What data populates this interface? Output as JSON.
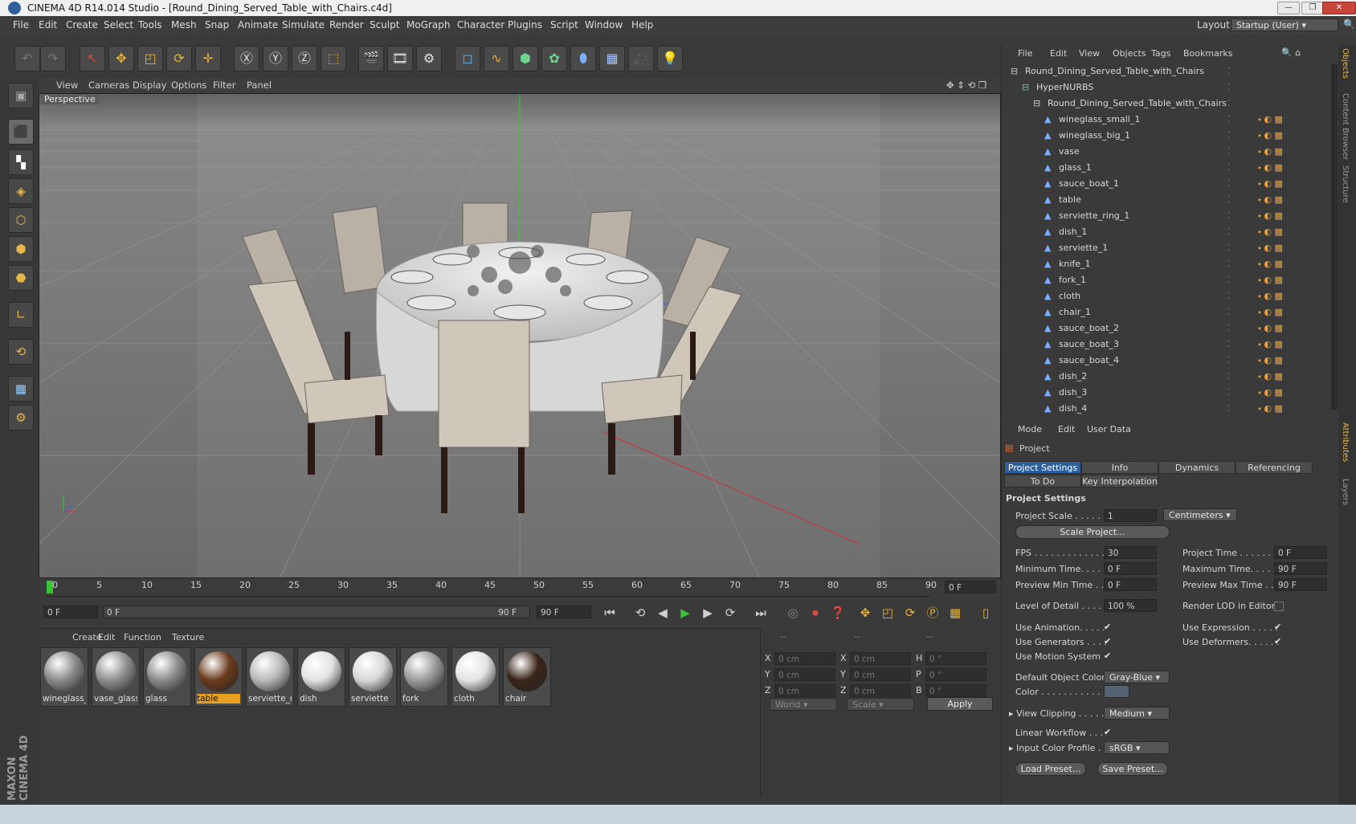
{
  "window": {
    "title": "CINEMA 4D R14.014 Studio - [Round_Dining_Served_Table_with_Chairs.c4d]"
  },
  "menubar": {
    "items": [
      "File",
      "Edit",
      "Create",
      "Select",
      "Tools",
      "Mesh",
      "Snap",
      "Animate",
      "Simulate",
      "Render",
      "Sculpt",
      "MoGraph",
      "Character",
      "Plugins",
      "Script",
      "Window",
      "Help"
    ],
    "layout_label": "Layout:",
    "layout_value": "Startup (User)"
  },
  "viewport": {
    "menu": [
      "View",
      "Cameras",
      "Display",
      "Options",
      "Filter",
      "Panel"
    ],
    "label": "Perspective"
  },
  "timeline": {
    "ticks": [
      "0",
      "5",
      "10",
      "15",
      "20",
      "25",
      "30",
      "35",
      "40",
      "45",
      "50",
      "55",
      "60",
      "65",
      "70",
      "75",
      "80",
      "85",
      "90"
    ],
    "current_frame": "0 F",
    "start": "0 F",
    "range_left": "0 F",
    "range_right": "90 F",
    "end": "90 F"
  },
  "materials": {
    "menu": [
      "Create",
      "Edit",
      "Function",
      "Texture"
    ],
    "items": [
      {
        "name": "wineglass_",
        "color": "#8a8a8a",
        "selected": false
      },
      {
        "name": "vase_glass",
        "color": "#8f8f8f",
        "selected": false
      },
      {
        "name": "glass",
        "color": "#8a8a8a",
        "selected": false
      },
      {
        "name": "table",
        "color": "#6b3a1c",
        "selected": true
      },
      {
        "name": "serviette_ri",
        "color": "#b9b9b9",
        "selected": false
      },
      {
        "name": "dish",
        "color": "#e2e2e2",
        "selected": false
      },
      {
        "name": "serviette",
        "color": "#d8d8d8",
        "selected": false
      },
      {
        "name": "fork",
        "color": "#9c9c9c",
        "selected": false
      },
      {
        "name": "cloth",
        "color": "#e5e5e5",
        "selected": false
      },
      {
        "name": "chair",
        "color": "#3a2418",
        "selected": false
      }
    ]
  },
  "coords": {
    "headers": [
      "--",
      "--",
      "--"
    ],
    "rows": [
      {
        "a": "X",
        "av": "0 cm",
        "b": "X",
        "bv": "0 cm",
        "c": "H",
        "cv": "0 °"
      },
      {
        "a": "Y",
        "av": "0 cm",
        "b": "Y",
        "bv": "0 cm",
        "c": "P",
        "cv": "0 °"
      },
      {
        "a": "Z",
        "av": "0 cm",
        "b": "Z",
        "bv": "0 cm",
        "c": "B",
        "cv": "0 °"
      }
    ],
    "mode1": "World",
    "mode2": "Scale",
    "apply": "Apply"
  },
  "objects": {
    "menu": [
      "File",
      "Edit",
      "View",
      "Objects",
      "Tags",
      "Bookmarks"
    ],
    "rows": [
      {
        "name": "Round_Dining_Served_Table_with_Chairs",
        "indent": 0
      },
      {
        "name": "HyperNURBS",
        "indent": 1
      },
      {
        "name": "Round_Dining_Served_Table_with_Chairs",
        "indent": 2
      },
      {
        "name": "wineglass_small_1",
        "indent": 3
      },
      {
        "name": "wineglass_big_1",
        "indent": 3
      },
      {
        "name": "vase",
        "indent": 3
      },
      {
        "name": "glass_1",
        "indent": 3
      },
      {
        "name": "sauce_boat_1",
        "indent": 3
      },
      {
        "name": "table",
        "indent": 3
      },
      {
        "name": "serviette_ring_1",
        "indent": 3
      },
      {
        "name": "dish_1",
        "indent": 3
      },
      {
        "name": "serviette_1",
        "indent": 3
      },
      {
        "name": "knife_1",
        "indent": 3
      },
      {
        "name": "fork_1",
        "indent": 3
      },
      {
        "name": "cloth",
        "indent": 3
      },
      {
        "name": "chair_1",
        "indent": 3
      },
      {
        "name": "sauce_boat_2",
        "indent": 3
      },
      {
        "name": "sauce_boat_3",
        "indent": 3
      },
      {
        "name": "sauce_boat_4",
        "indent": 3
      },
      {
        "name": "dish_2",
        "indent": 3
      },
      {
        "name": "dish_3",
        "indent": 3
      },
      {
        "name": "dish_4",
        "indent": 3
      }
    ]
  },
  "attributes": {
    "menu": [
      "Mode",
      "Edit",
      "User Data"
    ],
    "title": "Project",
    "tabs": [
      "Project Settings",
      "Info",
      "Dynamics",
      "Referencing"
    ],
    "tabs2": [
      "To Do",
      "Key Interpolation"
    ],
    "section": "Project Settings",
    "project_scale_label": "Project Scale . . . . . .",
    "project_scale": "1",
    "units": "Centimeters",
    "scale_project": "Scale Project...",
    "fps_label": "FPS . . . . . . . . . . . . . .",
    "fps": "30",
    "min_time_label": "Minimum Time. . . . .",
    "min_time": "0 F",
    "prev_min_label": "Preview Min Time . .",
    "prev_min": "0 F",
    "proj_time_label": "Project Time . . . . . . . .",
    "proj_time": "0 F",
    "max_time_label": "Maximum Time. . . . . .",
    "max_time": "90 F",
    "prev_max_label": "Preview Max Time . . .",
    "prev_max": "90 F",
    "lod_label": "Level of Detail . . . .",
    "lod": "100 %",
    "render_lod_label": "Render LOD in Editor",
    "use_anim_label": "Use Animation. . . . .",
    "use_gen_label": "Use Generators . . . .",
    "use_motion_label": "Use Motion System",
    "use_expr_label": "Use Expression . . . . .",
    "use_def_label": "Use Deformers. . . . . .",
    "def_color_label": "Default Object Color",
    "def_color": "Gray-Blue",
    "color_label": "Color . . . . . . . . . . .",
    "view_clip_label": "View Clipping . . . . .",
    "view_clip": "Medium",
    "linear_label": "Linear Workflow . . .",
    "input_profile_label": "Input Color Profile .",
    "input_profile": "sRGB",
    "load_preset": "Load Preset...",
    "save_preset": "Save Preset...",
    "check": "✔"
  },
  "side_tabs": [
    "Objects",
    "Content Browser",
    "Structure",
    "Attributes",
    "Layers"
  ],
  "brand": "MAXON CINEMA 4D"
}
